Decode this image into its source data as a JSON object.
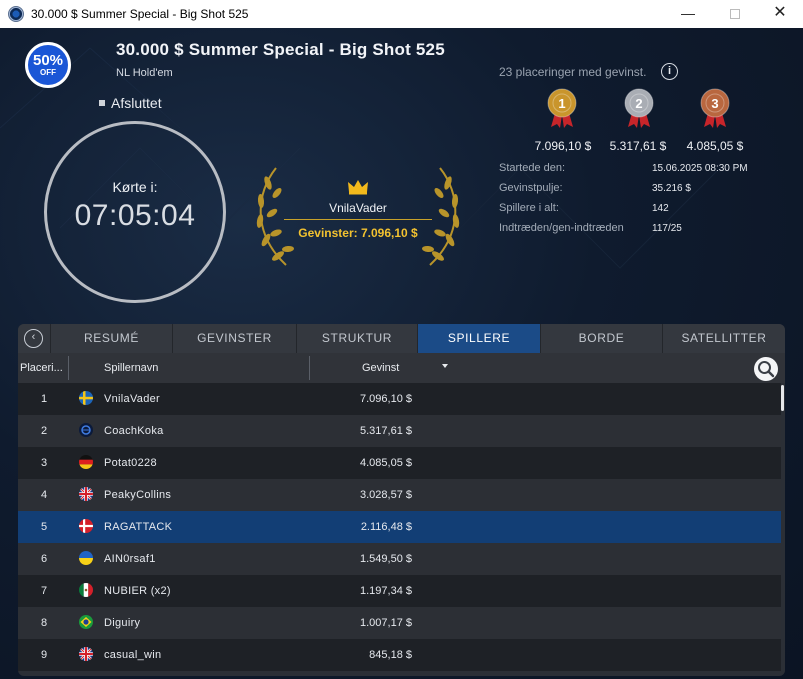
{
  "window": {
    "title": "30.000 $ Summer Special - Big Shot 525",
    "minimize": "—",
    "close": "✕"
  },
  "header": {
    "badge_pct": "50%",
    "badge_off": "OFF",
    "title": "30.000 $ Summer Special - Big Shot 525",
    "game": "NL Hold'em",
    "status": "Afsluttet"
  },
  "clock": {
    "label": "Kørte i:",
    "time": "07:05:04"
  },
  "winner": {
    "name": "VnilaVader",
    "prize_text": "Gevinster: 7.096,10 $"
  },
  "payouts": {
    "places_text": "23 placeringer med gevinst.",
    "info": "i",
    "medals": [
      {
        "rank": "1",
        "amount": "7.096,10 $",
        "color": "#c9952c"
      },
      {
        "rank": "2",
        "amount": "5.317,61 $",
        "color": "#a9adb4"
      },
      {
        "rank": "3",
        "amount": "4.085,05 $",
        "color": "#b9673f"
      }
    ]
  },
  "stats": [
    {
      "label": "Startede den:",
      "value": "15.06.2025   08:30 PM"
    },
    {
      "label": "Gevinstpulje:",
      "value": "35.216 $"
    },
    {
      "label": "Spillere i alt:",
      "value": "142"
    },
    {
      "label": "Indtræden/gen-indtræden",
      "value": "117/25"
    }
  ],
  "tabs": [
    {
      "label": "RESUMÉ",
      "active": false
    },
    {
      "label": "GEVINSTER",
      "active": false
    },
    {
      "label": "STRUKTUR",
      "active": false
    },
    {
      "label": "SPILLERE",
      "active": true
    },
    {
      "label": "BORDE",
      "active": false
    },
    {
      "label": "SATELLITTER",
      "active": false
    }
  ],
  "table": {
    "headers": {
      "place": "Placeri...",
      "name": "Spillernavn",
      "prize": "Gevinst"
    },
    "rows": [
      {
        "place": "1",
        "flag": "sweden",
        "name": "VnilaVader",
        "prize": "7.096,10 $"
      },
      {
        "place": "2",
        "flag": "globe",
        "name": "CoachKoka",
        "prize": "5.317,61 $"
      },
      {
        "place": "3",
        "flag": "germany",
        "name": "Potat0228",
        "prize": "4.085,05 $"
      },
      {
        "place": "4",
        "flag": "united-kingdom",
        "name": "PeakyCollins",
        "prize": "3.028,57 $"
      },
      {
        "place": "5",
        "flag": "denmark",
        "name": "RAGATTACK",
        "prize": "2.116,48 $",
        "selected": true
      },
      {
        "place": "6",
        "flag": "ukraine",
        "name": "AIN0rsaf1",
        "prize": "1.549,50 $"
      },
      {
        "place": "7",
        "flag": "mexico",
        "name": "NUBIER (x2)",
        "prize": "1.197,34 $"
      },
      {
        "place": "8",
        "flag": "brazil",
        "name": "Diguiry",
        "prize": "1.007,17 $"
      },
      {
        "place": "9",
        "flag": "united-kingdom",
        "name": "casual_win",
        "prize": "845,18 $"
      }
    ]
  }
}
